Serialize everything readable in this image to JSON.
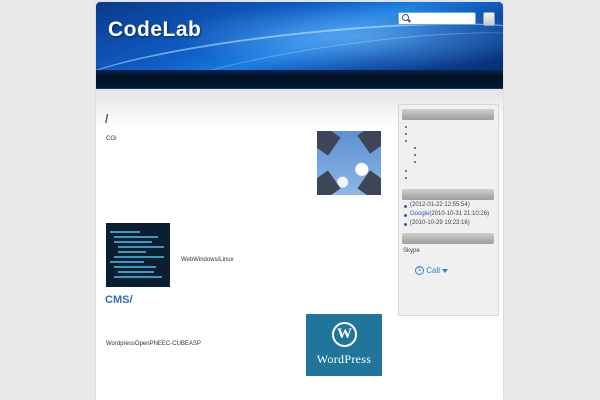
{
  "header": {
    "site_title": "CodeLab",
    "search_placeholder": ""
  },
  "main": {
    "post1": {
      "title": "/",
      "excerpt": "CGI",
      "caption": "WebWindows/Linux"
    },
    "post2": {
      "title": "CMS/",
      "excerpt": "WordpressOpenPNEEC-CUBEASP",
      "logo_mark": "W",
      "logo_text": "WordPress"
    }
  },
  "sidebar": {
    "recent_comments": [
      {
        "prefix": "",
        "link": "",
        "date": "(2012-01-22 12:55:54)"
      },
      {
        "prefix": "",
        "link": "Google",
        "date": "(2010-10-31 21:10:26)"
      },
      {
        "prefix": "",
        "link": "",
        "date": "(2010-10-29 19:23:16)"
      }
    ],
    "skype_label": "Skype",
    "call_label": "Call"
  },
  "colors": {
    "header_blue": "#0f5fc8",
    "link_blue": "#2d5fb0",
    "wordpress_blue": "#21759b"
  }
}
